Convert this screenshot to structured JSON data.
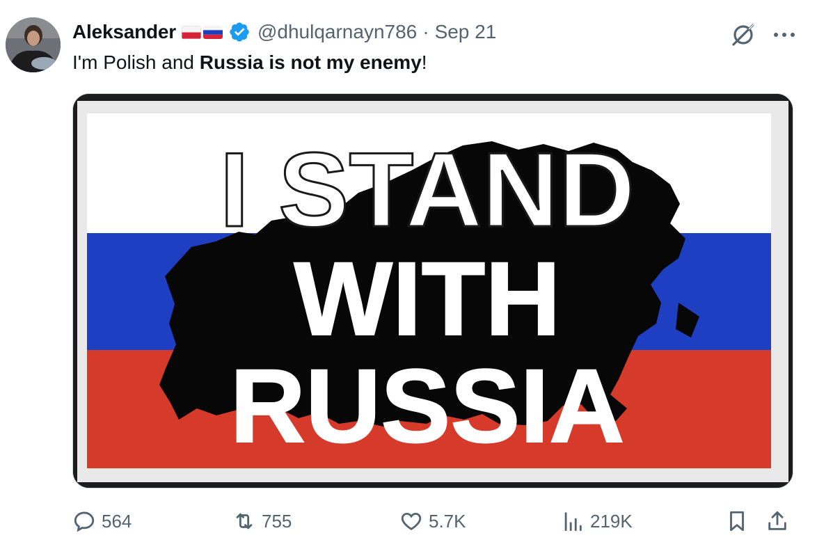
{
  "tweet": {
    "display_name": "Aleksander",
    "flags": [
      "poland-flag-icon",
      "russia-flag-icon"
    ],
    "verified_icon": "verified-badge-icon",
    "handle": "@dhulqarnayn786",
    "separator": "·",
    "date": "Sep 21",
    "text_parts": [
      {
        "text": "I'm Polish and ",
        "bold": false
      },
      {
        "text": "Russia is not my enemy",
        "bold": true
      },
      {
        "text": "!",
        "bold": false
      }
    ],
    "image": {
      "line1": "I STAND",
      "line2": "WITH",
      "line3": "RUSSIA",
      "flag_colors": [
        "#ffffff",
        "#1f3fc2",
        "#d63a2b"
      ]
    }
  },
  "actions": {
    "reply_count": "564",
    "repost_count": "755",
    "like_count": "5.7K",
    "views_count": "219K"
  },
  "colors": {
    "text": "#0f1419",
    "muted": "#536471",
    "verified": "#1d9bf0"
  }
}
